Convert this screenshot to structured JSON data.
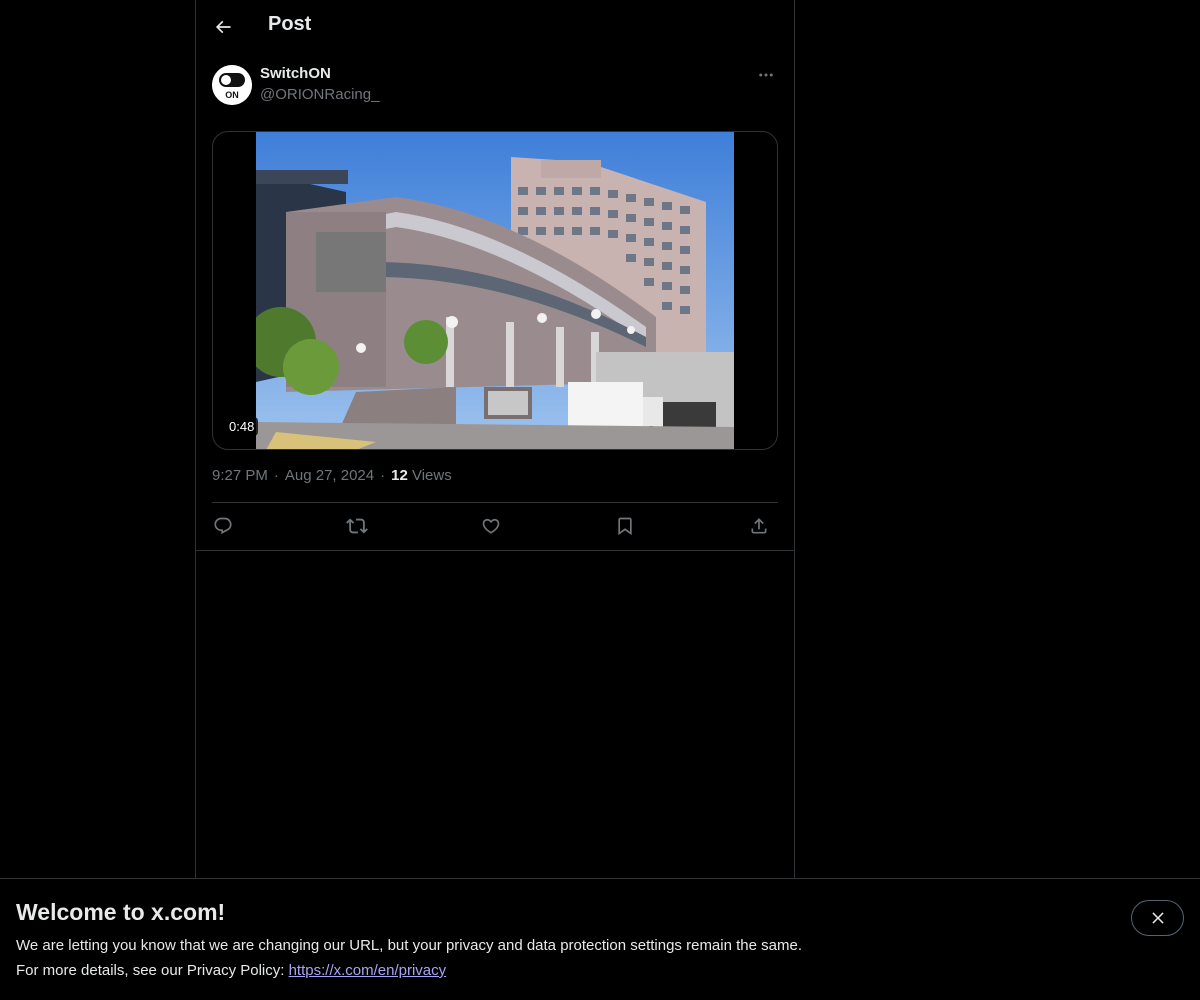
{
  "header": {
    "title": "Post",
    "back_icon": "arrow-left-icon"
  },
  "post": {
    "author": {
      "name": "SwitchON",
      "handle": "@ORIONRacing_",
      "avatar_text": "ON"
    },
    "media": {
      "duration": "0:48"
    },
    "time": "9:27 PM",
    "separator": "·",
    "date": "Aug 27, 2024",
    "views_count": "12",
    "views_label": "Views",
    "actions": [
      {
        "name": "reply",
        "icon": "reply-icon"
      },
      {
        "name": "repost",
        "icon": "repost-icon"
      },
      {
        "name": "like",
        "icon": "heart-icon"
      },
      {
        "name": "bookmark",
        "icon": "bookmark-icon"
      },
      {
        "name": "share",
        "icon": "share-icon"
      }
    ]
  },
  "banner": {
    "title": "Welcome to x.com!",
    "line1": "We are letting you know that we are changing our URL, but your privacy and data protection settings remain the same.",
    "line2_prefix": "For more details, see our Privacy Policy: ",
    "link": "https://x.com/en/privacy"
  },
  "colors": {
    "background": "#000000",
    "text": "#e7e9ea",
    "muted": "#71767b",
    "border": "#2f3336",
    "link": "#a9a3f5"
  }
}
